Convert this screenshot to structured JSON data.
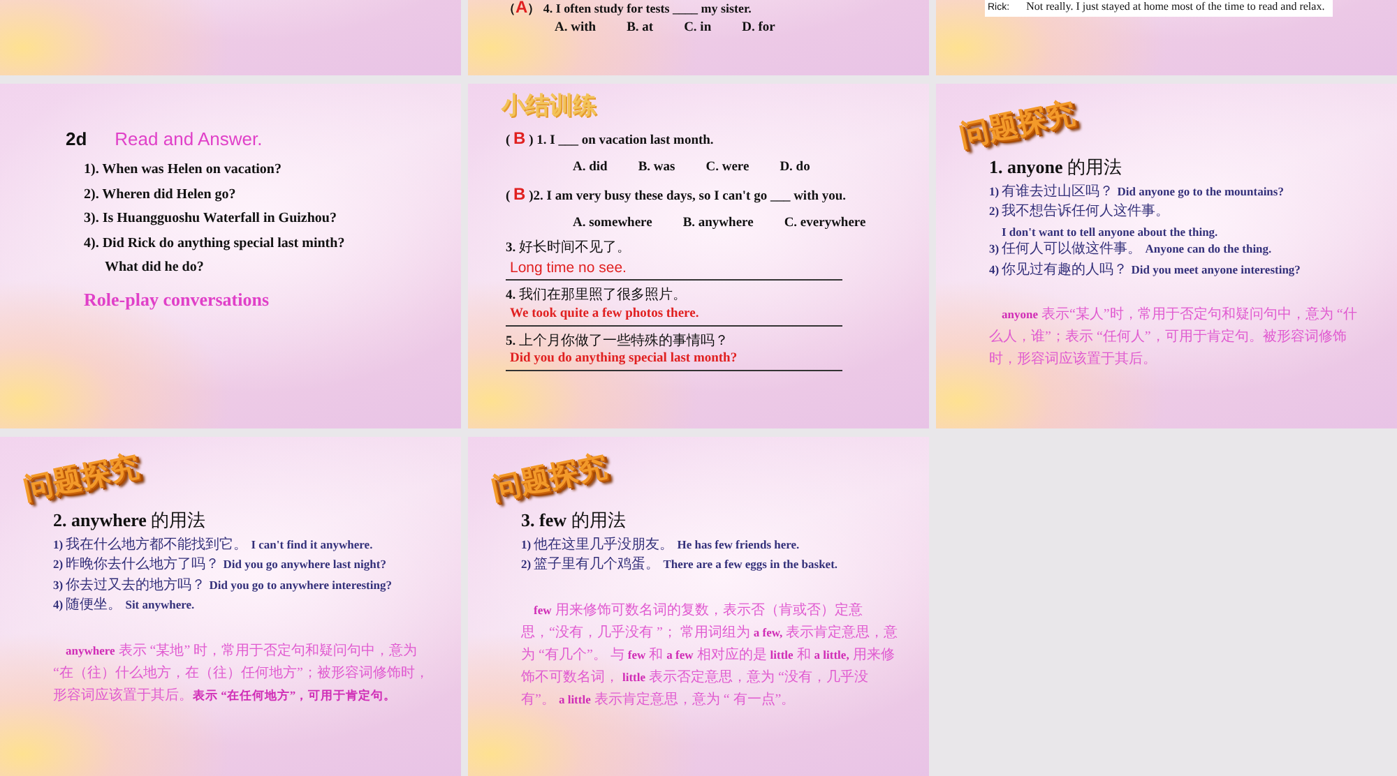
{
  "slides": [
    {
      "kind": "clipped"
    },
    {
      "kind": "clipped",
      "lines": [
        {
          "kind": "exercise",
          "parts": [
            {
              "text": "（",
              "kind": "text"
            },
            {
              "text": "A",
              "kind": "mark"
            },
            {
              "text": "） 4. I often study for tests ____ my sister.",
              "kind": "text"
            }
          ]
        },
        {
          "kind": "row",
          "parts": [
            {
              "text": "A. with",
              "kind": "option"
            },
            {
              "text": "B. at",
              "kind": "option"
            },
            {
              "text": "C. in",
              "kind": "option"
            },
            {
              "text": "D. for",
              "kind": "option"
            }
          ]
        }
      ]
    },
    {
      "kind": "clipped",
      "lines": [
        {
          "kind": "caption",
          "parts": [
            {
              "text": "Rick:",
              "kind": "speaker"
            },
            {
              "text": "Not really. I just stayed at home most of the time to read and relax.",
              "kind": "text"
            }
          ]
        }
      ]
    },
    {
      "kind": "full",
      "lines": [
        {
          "kind": "row",
          "parts": [
            {
              "text": "2d",
              "kind": "number"
            },
            {
              "text": "Read and Answer.",
              "kind": "title"
            }
          ]
        },
        {
          "kind": "question",
          "parts": [
            {
              "text": "1). When was Helen on vacation?",
              "kind": "text"
            }
          ]
        },
        {
          "kind": "question",
          "parts": [
            {
              "text": "2). Wheren did Helen go?",
              "kind": "text"
            }
          ]
        },
        {
          "kind": "question",
          "parts": [
            {
              "text": "3). Is Huangguoshu Waterfall in Guizhou?",
              "kind": "text"
            }
          ]
        },
        {
          "kind": "question",
          "parts": [
            {
              "text": "4). Did Rick do anything special last minth?",
              "kind": "text"
            }
          ]
        },
        {
          "kind": "question-cont",
          "parts": [
            {
              "text": "What did he do?",
              "kind": "text"
            }
          ]
        },
        {
          "kind": "task",
          "parts": [
            {
              "text": "Role-play conversations",
              "kind": "text"
            }
          ]
        }
      ]
    },
    {
      "kind": "full",
      "lines": [
        {
          "kind": "title",
          "parts": [
            {
              "text": "小结训练",
              "kind": "text"
            }
          ]
        },
        {
          "kind": "exercise",
          "parts": [
            {
              "text": "( ",
              "kind": "text"
            },
            {
              "text": "B",
              "kind": "mark"
            },
            {
              "text": " ) 1. I ___ on vacation last month.",
              "kind": "text"
            }
          ]
        },
        {
          "kind": "row",
          "parts": [
            {
              "text": "A. did",
              "kind": "option"
            },
            {
              "text": "B. was",
              "kind": "option"
            },
            {
              "text": "C. were",
              "kind": "option"
            },
            {
              "text": "D. do",
              "kind": "option"
            }
          ]
        },
        {
          "kind": "exercise",
          "parts": [
            {
              "text": "( ",
              "kind": "text"
            },
            {
              "text": "B",
              "kind": "mark"
            },
            {
              "text": " )2. I am very busy these days, so I can't go ___ with you.",
              "kind": "text"
            }
          ]
        },
        {
          "kind": "row",
          "parts": [
            {
              "text": "A. somewhere",
              "kind": "option"
            },
            {
              "text": "B. anywhere",
              "kind": "option"
            },
            {
              "text": "C. everywhere",
              "kind": "option"
            }
          ]
        },
        {
          "kind": "exercise",
          "parts": [
            {
              "text": "3. ",
              "kind": "text"
            },
            {
              "text": "好长时间不见了。",
              "kind": "zh"
            }
          ]
        },
        {
          "kind": "answer-sans",
          "parts": [
            {
              "text": "Long time no see.",
              "kind": "text"
            }
          ]
        },
        {
          "kind": "exercise",
          "parts": [
            {
              "text": "4. ",
              "kind": "text"
            },
            {
              "text": "我们在那里照了很多照片。",
              "kind": "zh"
            }
          ]
        },
        {
          "kind": "answer",
          "parts": [
            {
              "text": "We took quite a few photos there.",
              "kind": "text"
            }
          ]
        },
        {
          "kind": "exercise",
          "parts": [
            {
              "text": "5. ",
              "kind": "text"
            },
            {
              "text": "上个月你做了一些特殊的事情吗？",
              "kind": "zh"
            }
          ]
        },
        {
          "kind": "answer",
          "parts": [
            {
              "text": "Did you do anything special last month?",
              "kind": "text"
            }
          ]
        }
      ]
    },
    {
      "kind": "full",
      "lines": [
        {
          "kind": "banner",
          "parts": [
            {
              "text": "问题探究",
              "kind": "text"
            }
          ]
        },
        {
          "kind": "heading",
          "parts": [
            {
              "text": "1. anyone ",
              "kind": "text"
            },
            {
              "text": "的用法",
              "kind": "zh"
            }
          ]
        },
        {
          "kind": "example",
          "parts": [
            {
              "text": "1) ",
              "kind": "text"
            },
            {
              "text": "有谁去过山区吗？ ",
              "kind": "zh"
            },
            {
              "text": "Did anyone go to the mountains?",
              "kind": "text"
            }
          ]
        },
        {
          "kind": "example",
          "parts": [
            {
              "text": "2) ",
              "kind": "text"
            },
            {
              "text": "我不想告诉任何人这件事。",
              "kind": "zh"
            }
          ]
        },
        {
          "kind": "example-cont",
          "parts": [
            {
              "text": "I don't want to tell anyone about the thing.",
              "kind": "text"
            }
          ]
        },
        {
          "kind": "example",
          "parts": [
            {
              "text": "3) ",
              "kind": "text"
            },
            {
              "text": "任何人可以做这件事。 ",
              "kind": "zh"
            },
            {
              "text": "Anyone can do the thing.",
              "kind": "text"
            }
          ]
        },
        {
          "kind": "example",
          "parts": [
            {
              "text": "4) ",
              "kind": "text"
            },
            {
              "text": "你见过有趣的人吗？ ",
              "kind": "zh"
            },
            {
              "text": "Did you meet anyone interesting?",
              "kind": "text"
            }
          ]
        },
        {
          "kind": "note",
          "parts": [
            {
              "text": "anyone",
              "kind": "key"
            },
            {
              "text": " 表示“某人”时，常用于否定句和疑问句中，意为 “什么人，谁”；表示 “任何人”，可用于肯定句。被形容词修饰时，形容词应该置于其后。",
              "kind": "zh"
            }
          ]
        }
      ]
    },
    {
      "kind": "full",
      "lines": [
        {
          "kind": "banner",
          "parts": [
            {
              "text": "问题探究",
              "kind": "text"
            }
          ]
        },
        {
          "kind": "heading",
          "parts": [
            {
              "text": "2. anywhere ",
              "kind": "text"
            },
            {
              "text": "的用法",
              "kind": "zh"
            }
          ]
        },
        {
          "kind": "example",
          "parts": [
            {
              "text": "1) ",
              "kind": "text"
            },
            {
              "text": "我在什么地方都不能找到它。 ",
              "kind": "zh"
            },
            {
              "text": "I can't find it anywhere.",
              "kind": "text"
            }
          ]
        },
        {
          "kind": "example",
          "parts": [
            {
              "text": "2) ",
              "kind": "text"
            },
            {
              "text": "昨晚你去什么地方了吗？ ",
              "kind": "zh"
            },
            {
              "text": "Did you go anywhere last night?",
              "kind": "text"
            }
          ]
        },
        {
          "kind": "example",
          "parts": [
            {
              "text": "3) ",
              "kind": "text"
            },
            {
              "text": "你去过又去的地方吗？ ",
              "kind": "zh"
            },
            {
              "text": "Did you go to anywhere interesting?",
              "kind": "text"
            }
          ]
        },
        {
          "kind": "example",
          "parts": [
            {
              "text": "4) ",
              "kind": "text"
            },
            {
              "text": "随便坐。 ",
              "kind": "zh"
            },
            {
              "text": "Sit anywhere.",
              "kind": "text"
            }
          ]
        },
        {
          "kind": "note",
          "parts": [
            {
              "text": "anywhere",
              "kind": "key"
            },
            {
              "text": " 表示 “某地” 时，常用于否定句和疑问句中，意为 “在（往）什么地方，在（往）任何地方”；被形容词修饰时，形容词应该置于其后。",
              "kind": "zh"
            },
            {
              "text": "表示 “在任何地方”，可用于肯定句。",
              "kind": "key"
            }
          ]
        }
      ]
    },
    {
      "kind": "full",
      "lines": [
        {
          "kind": "banner",
          "parts": [
            {
              "text": "问题探究",
              "kind": "text"
            }
          ]
        },
        {
          "kind": "heading",
          "parts": [
            {
              "text": "3. few ",
              "kind": "text"
            },
            {
              "text": "的用法",
              "kind": "zh"
            }
          ]
        },
        {
          "kind": "example",
          "parts": [
            {
              "text": "1) ",
              "kind": "text"
            },
            {
              "text": "他在这里几乎没朋友。 ",
              "kind": "zh"
            },
            {
              "text": "He has few friends here.",
              "kind": "text"
            }
          ]
        },
        {
          "kind": "example",
          "parts": [
            {
              "text": "2) ",
              "kind": "text"
            },
            {
              "text": "篮子里有几个鸡蛋。 ",
              "kind": "zh"
            },
            {
              "text": "There are a few eggs in the basket.",
              "kind": "text"
            }
          ]
        },
        {
          "kind": "note",
          "parts": [
            {
              "text": "few",
              "kind": "key"
            },
            {
              "text": " 用来修饰可数名词的复数，表示否（肯或否）定意思，“没有，几乎没有 ”； 常用词组为 ",
              "kind": "zh"
            },
            {
              "text": "a few,",
              "kind": "key"
            },
            {
              "text": " 表示肯定意思，意为 “有几个”。 与 ",
              "kind": "zh"
            },
            {
              "text": "few",
              "kind": "key"
            },
            {
              "text": " 和 ",
              "kind": "zh"
            },
            {
              "text": "a few",
              "kind": "key"
            },
            {
              "text": " 相对应的是 ",
              "kind": "zh"
            },
            {
              "text": "little",
              "kind": "key"
            },
            {
              "text": " 和 ",
              "kind": "zh"
            },
            {
              "text": "a little,",
              "kind": "key"
            },
            {
              "text": " 用来修饰不可数名词， ",
              "kind": "zh"
            },
            {
              "text": "little",
              "kind": "key"
            },
            {
              "text": " 表示否定意思，意为 “没有，几乎没有”。 ",
              "kind": "zh"
            },
            {
              "text": "a little",
              "kind": "key"
            },
            {
              "text": " 表示肯定意思，意为 “ 有一点”。",
              "kind": "zh"
            }
          ]
        }
      ]
    }
  ]
}
